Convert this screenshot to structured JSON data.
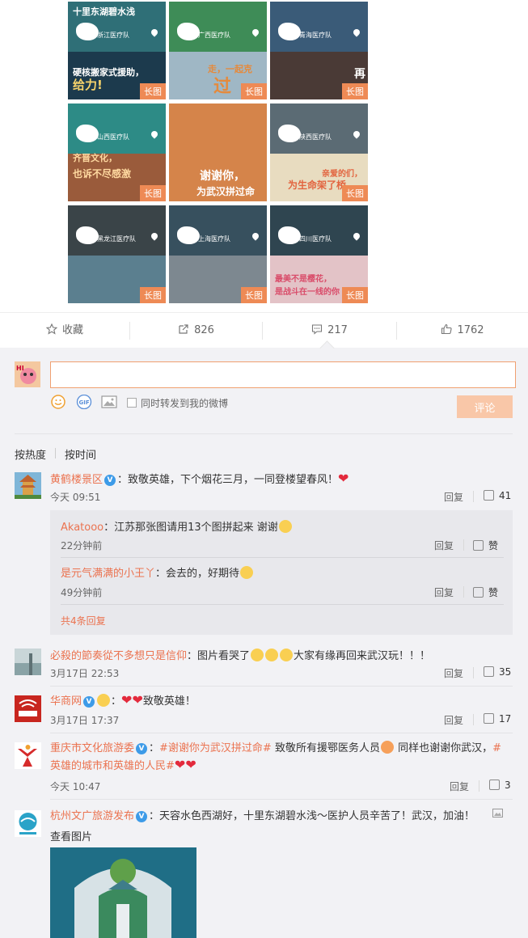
{
  "image_grid": {
    "badge_label": "长图",
    "tiles": [
      {
        "headline": "十里东湖碧水浅",
        "team": "浙江医疗队",
        "caption": "硬核搬家式援助，",
        "caption2": "给力!",
        "top_color": "#2f6f77",
        "bottom_color": "#1c3a4d"
      },
      {
        "headline": "",
        "team": "广西医疗队",
        "caption": "走，一起克",
        "caption2": "过",
        "top_color": "#3e8c57",
        "bottom_color": "#9fb7c5"
      },
      {
        "headline": "",
        "team": "青海医疗队",
        "caption": "",
        "caption2": "再",
        "top_color": "#3a5b78",
        "bottom_color": "#4a3a36"
      },
      {
        "headline": "",
        "team": "山西医疗队",
        "caption": "齐晋文化，",
        "caption2": "也诉不尽感激",
        "top_color": "#2d8b86",
        "bottom_color": "#9a5b3b"
      },
      {
        "headline": "",
        "team": "",
        "caption": "谢谢你，",
        "caption2": "为武汉拼过命",
        "top_color": "#d5844a",
        "bottom_color": "#a35a35"
      },
      {
        "headline": "",
        "team": "陕西医疗队",
        "caption": "亲爱的们，",
        "caption2": "为生命架了桥",
        "top_color": "#5b6b74",
        "bottom_color": "#e8dcc0"
      },
      {
        "headline": "",
        "team": "黑龙江医疗队",
        "caption": "",
        "caption2": "",
        "top_color": "#3a4448",
        "bottom_color": "#5b7f8f"
      },
      {
        "headline": "",
        "team": "上海医疗队",
        "caption": "",
        "caption2": "",
        "top_color": "#37505e",
        "bottom_color": "#7d8890"
      },
      {
        "headline": "",
        "team": "四川医疗队",
        "caption": "最美不是樱花，",
        "caption2": "是战斗在一线的你",
        "top_color": "#2f4550",
        "bottom_color": "#e3c3c7"
      }
    ]
  },
  "action_bar": {
    "favorite": "收藏",
    "repost_count": "826",
    "comment_count": "217",
    "like_count": "1762"
  },
  "composer": {
    "input_value": "",
    "sync_label": "同时转发到我的微博",
    "submit_label": "评论",
    "gif_label": "GIF"
  },
  "sort": {
    "by_heat": "按热度",
    "by_time": "按时间"
  },
  "comments": [
    {
      "user": "黄鹤楼景区",
      "text": "：致敬英雄，下个烟花三月，一同登楼望春风！",
      "time": "今天 09:51",
      "reply": "回复",
      "likes": "41",
      "heart": "❤"
    },
    {
      "user": "必殺的節奏從不多想只是信仰",
      "text_a": "：图片看哭了",
      "text_b": "大家有缘再回来武汉玩！！！",
      "time": "3月17日 22:53",
      "reply": "回复",
      "likes": "35"
    },
    {
      "user": "华商网",
      "text": "致敬英雄！",
      "separator": "：",
      "hearts": "❤❤",
      "time": "3月17日 17:37",
      "reply": "回复",
      "likes": "17"
    },
    {
      "user": "重庆市文化旅游委",
      "tag1": "#谢谢你为武汉拼过命#",
      "text1": "致敬所有援鄂医务人员",
      "text2": "同样也谢谢你武汉，",
      "tag2_a": "#",
      "tag2_b": "英雄的城市和英雄的人民#",
      "hearts": "❤❤",
      "time": "今天 10:47",
      "reply": "回复",
      "likes": "3"
    },
    {
      "user": "杭州文广旅游发布",
      "text": "：天容水色西湖好，十里东湖碧水浅～医护人员辛苦了！武汉，加油！",
      "view_image": "查看图片"
    }
  ],
  "sub_replies": [
    {
      "user": "Akatooo",
      "text": "：江苏那张图请用13个图拼起来 谢谢",
      "time": "22分钟前",
      "reply": "回复",
      "like": "赞"
    },
    {
      "user": "是元气满满的小王丫",
      "text": "：会去的，好期待",
      "time": "49分钟前",
      "reply": "回复",
      "like": "赞"
    }
  ],
  "sub_more": "共4条回复",
  "colors": {
    "accent": "#eb7350",
    "badge": "#ee8a55",
    "verified": "#3d9be8",
    "heart": "#e32a3c",
    "submit_disabled": "#f9c7a8"
  }
}
